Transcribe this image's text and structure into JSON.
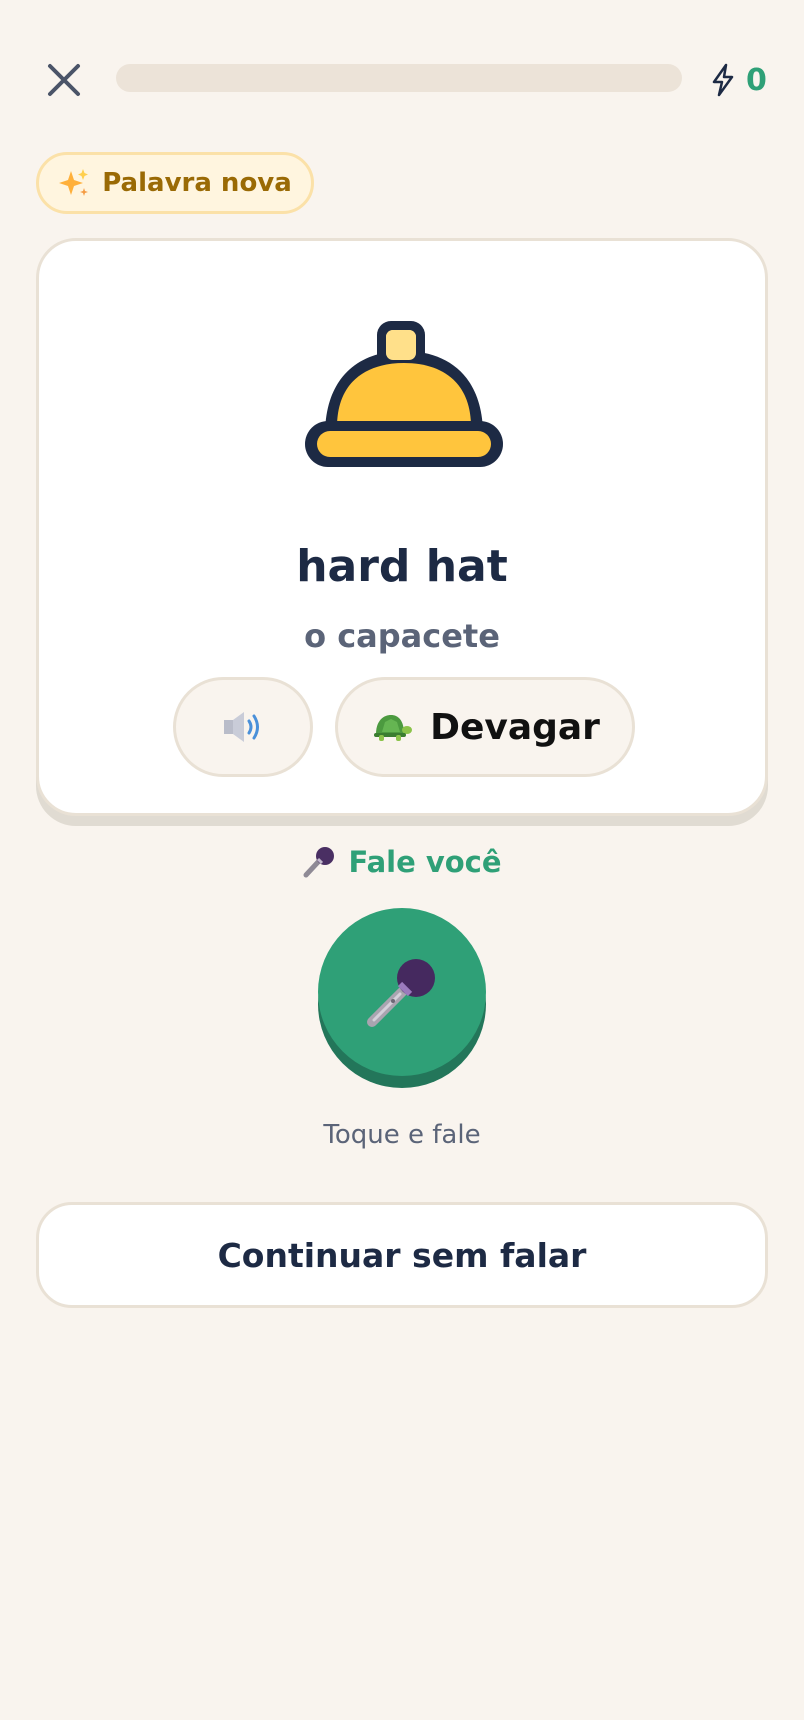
{
  "header": {
    "close_icon": "close-icon",
    "progress": 0,
    "xp_icon": "lightning-bolt-icon",
    "xp_value": "0"
  },
  "badge": {
    "icon": "sparkles-icon",
    "label": "Palavra nova"
  },
  "card": {
    "image_icon": "hard-hat-icon",
    "word": "hard hat",
    "translation": "o capacete",
    "audio_icon": "speaker-icon",
    "slow_icon": "turtle-icon",
    "slow_label": "Devagar"
  },
  "speak": {
    "icon": "microphone-icon",
    "title": "Fale você",
    "mic_icon": "microphone-icon",
    "hint": "Toque e fale"
  },
  "footer": {
    "continue_label": "Continuar sem falar"
  },
  "colors": {
    "background": "#f9f4ee",
    "accent_green": "#2fa077",
    "text_dark": "#1d2a44",
    "text_muted": "#5b6478",
    "badge_text": "#9a6a05",
    "hat_yellow": "#ffc53d"
  }
}
